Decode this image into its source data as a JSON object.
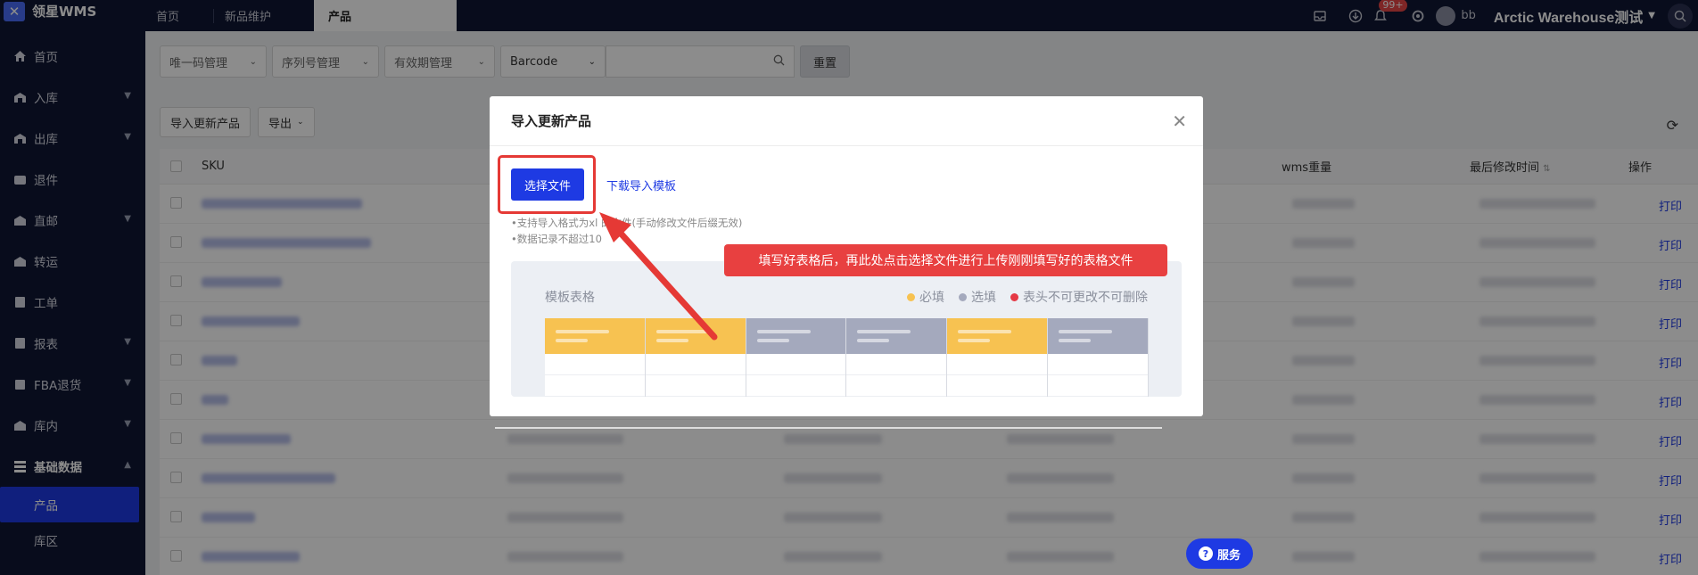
{
  "app": {
    "logo_text": "领星WMS"
  },
  "sidebar": {
    "items": [
      {
        "label": "首页",
        "icon": "home-icon",
        "has_chevron": false
      },
      {
        "label": "入库",
        "icon": "inbound-icon",
        "has_chevron": true
      },
      {
        "label": "出库",
        "icon": "outbound-icon",
        "has_chevron": true
      },
      {
        "label": "退件",
        "icon": "return-icon",
        "has_chevron": false
      },
      {
        "label": "直邮",
        "icon": "direct-mail-icon",
        "has_chevron": true
      },
      {
        "label": "转运",
        "icon": "transfer-icon",
        "has_chevron": false
      },
      {
        "label": "工单",
        "icon": "ticket-icon",
        "has_chevron": false
      },
      {
        "label": "报表",
        "icon": "report-icon",
        "has_chevron": true
      },
      {
        "label": "FBA退货",
        "icon": "fba-icon",
        "has_chevron": true
      },
      {
        "label": "库内",
        "icon": "warehouse-icon",
        "has_chevron": true
      }
    ],
    "group": {
      "label": "基础数据",
      "icon": "grid-icon"
    },
    "sub_items": [
      {
        "label": "产品",
        "active": true
      },
      {
        "label": "库区",
        "active": false
      }
    ]
  },
  "topbar": {
    "tabs": [
      {
        "label": "首页"
      },
      {
        "label": "新品维护"
      },
      {
        "label": "产品"
      }
    ],
    "notification_badge": "99+",
    "user_name": "bb",
    "company": "Arctic Warehouse测试"
  },
  "filters": {
    "unique_code": "唯一码管理",
    "serial_number": "序列号管理",
    "expiry": "有效期管理",
    "field": "Barcode",
    "search_value": "",
    "reset": "重置"
  },
  "actions": {
    "import_update": "导入更新产品",
    "export": "导出"
  },
  "table": {
    "headers": {
      "sku": "SKU",
      "weight": "wms重量",
      "modified": "最后修改时间",
      "ops": "操作"
    },
    "row_action": "打印",
    "row_count": 10
  },
  "modal": {
    "title": "导入更新产品",
    "choose_file": "选择文件",
    "download_template": "下载导入模板",
    "hints": [
      "•支持导入格式为xl    的文件(手动修改文件后缀无效)",
      "•数据记录不超过10"
    ],
    "callout": "填写好表格后，再此处点击选择文件进行上传刚刚填写好的表格文件",
    "template_title": "模板表格",
    "legend": [
      {
        "label": "必填",
        "color": "#f7c251"
      },
      {
        "label": "选填",
        "color": "#a4a9bd"
      },
      {
        "label": "表头不可更改不可删除",
        "color": "#e53945"
      }
    ]
  },
  "service_button": "服务",
  "colors": {
    "primary": "#1e3ae3",
    "sidebar_bg": "#0f1633",
    "annotation_red": "#e53935"
  }
}
